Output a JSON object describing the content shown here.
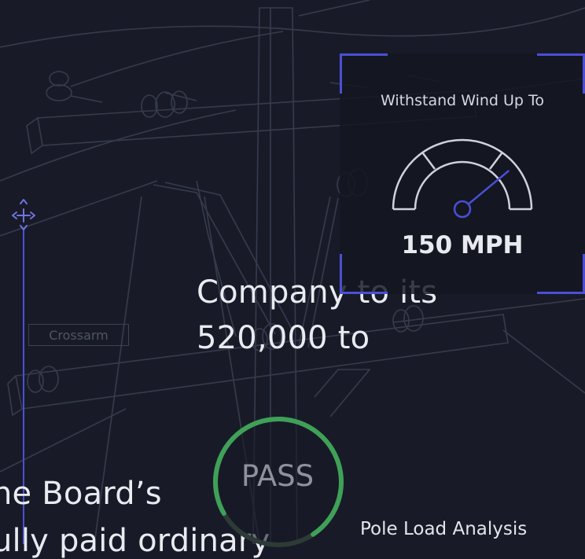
{
  "body_text": {
    "line1": "Company to its",
    "line2": "520,000 to",
    "line3": "he Board’s",
    "line4": "ully paid ordinary"
  },
  "wind_card": {
    "label": "Withstand Wind Up To",
    "value": "150 MPH",
    "gauge_level": 0.78
  },
  "pass_badge": {
    "text": "PASS",
    "progress": 0.74
  },
  "pole_caption": "Pole Load Analysis",
  "background_label": "Crossarm",
  "colors": {
    "background": "#181b27",
    "accent_blue": "#4a4fd6",
    "pass_green": "#3fa157",
    "blueprint_line": "#3a3f52"
  },
  "icons": {
    "move_handle": "move-arrows-icon",
    "pole": "utility-pole-blueprint"
  }
}
